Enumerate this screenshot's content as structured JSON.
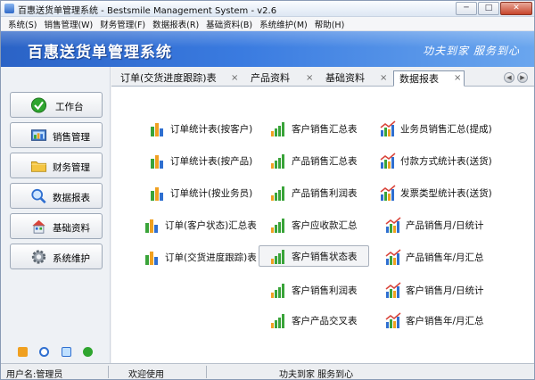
{
  "window": {
    "title": "百惠送货单管理系统 - Bestsmile Management System - v2.6",
    "minimize": "─",
    "maximize": "□",
    "close": "✕"
  },
  "menu": [
    "系统(S)",
    "销售管理(W)",
    "财务管理(F)",
    "数据报表(R)",
    "基础资料(B)",
    "系统维护(M)",
    "帮助(H)"
  ],
  "banner": {
    "title": "百惠送货单管理系统",
    "slogan": "功夫到家 服务到心"
  },
  "sidebar": {
    "items": [
      {
        "label": "工作台",
        "icon": "check-icon"
      },
      {
        "label": "销售管理",
        "icon": "sales-icon"
      },
      {
        "label": "财务管理",
        "icon": "folder-icon"
      },
      {
        "label": "数据报表",
        "icon": "magnifier-icon"
      },
      {
        "label": "基础资料",
        "icon": "building-icon"
      },
      {
        "label": "系统维护",
        "icon": "gear-icon"
      }
    ]
  },
  "tabs": [
    {
      "label": "订单(交货进度跟踪)表",
      "close": "×"
    },
    {
      "label": "产品资料",
      "close": "×"
    },
    {
      "label": "基础资料",
      "close": "×"
    },
    {
      "label": "数据报表",
      "close": "×"
    }
  ],
  "reports": {
    "col1": [
      "订单统计表(按客户)",
      "订单统计表(按产品)",
      "订单统计(按业务员)",
      "订单(客户状态)汇总表",
      "订单(交货进度跟踪)表"
    ],
    "col2": [
      "客户销售汇总表",
      "产品销售汇总表",
      "产品销售利润表",
      "客户应收款汇总",
      "客户销售状态表",
      "客户销售利润表",
      "客户产品交叉表"
    ],
    "col3": [
      "业务员销售汇总(提成)",
      "付款方式统计表(送货)",
      "发票类型统计表(送货)",
      "产品销售月/日统计",
      "产品销售年/月汇总",
      "客户销售月/日统计",
      "客户销售年/月汇总"
    ]
  },
  "status": {
    "user": "用户名:管理员",
    "welcome": "欢迎使用",
    "slogan": "功夫到家 服务到心"
  },
  "colors": {
    "banner": "#2b63c6",
    "bar_green": "#3aa43a",
    "bar_orange": "#f0a020",
    "bar_blue": "#2f6fd0"
  }
}
